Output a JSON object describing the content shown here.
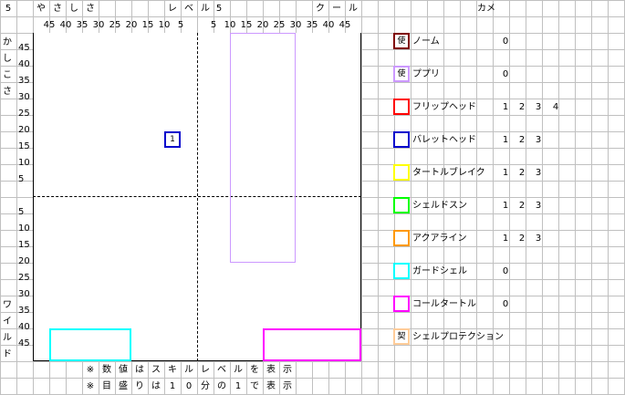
{
  "corner_label": "5",
  "top_left_title": [
    "や",
    "さ",
    "し",
    "さ"
  ],
  "top_mid_title": [
    "レ",
    "ベ",
    "ル"
  ],
  "top_mid_value": "5",
  "top_right_title": [
    "ク",
    "ー",
    "ル"
  ],
  "camera_label": "カメ",
  "left_title_top": [
    "か",
    "し",
    "こ",
    "さ"
  ],
  "left_title_bottom": [
    "ワ",
    "イ",
    "ル",
    "ド"
  ],
  "x_ticks_left": [
    "45",
    "40",
    "35",
    "30",
    "25",
    "20",
    "15",
    "10",
    "5"
  ],
  "x_ticks_right": [
    "5",
    "10",
    "15",
    "20",
    "25",
    "30",
    "35",
    "40",
    "45"
  ],
  "y_ticks_top": [
    "45",
    "40",
    "35",
    "30",
    "25",
    "20",
    "15",
    "10",
    "5"
  ],
  "y_ticks_bottom": [
    "5",
    "10",
    "15",
    "20",
    "25",
    "30",
    "35",
    "40",
    "45"
  ],
  "notes": [
    [
      "※",
      "数",
      "値",
      "は",
      "ス",
      "キ",
      "ル",
      "レ",
      "ベ",
      "ル",
      "を",
      "表",
      "示"
    ],
    [
      "※",
      "目",
      "盛",
      "り",
      "は",
      "1",
      "0",
      "分",
      "の",
      "1",
      "で",
      "表",
      "示"
    ]
  ],
  "marker": {
    "label": "1",
    "color": "#0000cc"
  },
  "legend": [
    {
      "icon_text": "使",
      "name": "ノーム",
      "color": "#800000",
      "values": [
        "0"
      ]
    },
    {
      "icon_text": "使",
      "name": "ププリ",
      "color": "#cc99ff",
      "values": [
        "0"
      ]
    },
    {
      "icon_text": "",
      "name": "フリップヘッド",
      "color": "#ff0000",
      "values": [
        "1",
        "2",
        "3",
        "4"
      ]
    },
    {
      "icon_text": "",
      "name": "バレットヘッド",
      "color": "#0000cc",
      "values": [
        "1",
        "2",
        "3"
      ]
    },
    {
      "icon_text": "",
      "name": "タートルブレイク",
      "color": "#ffff00",
      "values": [
        "1",
        "2",
        "3"
      ]
    },
    {
      "icon_text": "",
      "name": "シェルドスン",
      "color": "#00ff00",
      "values": [
        "1",
        "2",
        "3"
      ]
    },
    {
      "icon_text": "",
      "name": "アクアライン",
      "color": "#ff9900",
      "values": [
        "1",
        "2",
        "3"
      ]
    },
    {
      "icon_text": "",
      "name": "ガードシェル",
      "color": "#00ffff",
      "values": [
        "0"
      ]
    },
    {
      "icon_text": "",
      "name": "コールタートル",
      "color": "#ff00ff",
      "values": [
        "0"
      ]
    },
    {
      "icon_text": "契",
      "name": "シェルプロテクション",
      "color": "#ffcc99",
      "values": []
    }
  ]
}
